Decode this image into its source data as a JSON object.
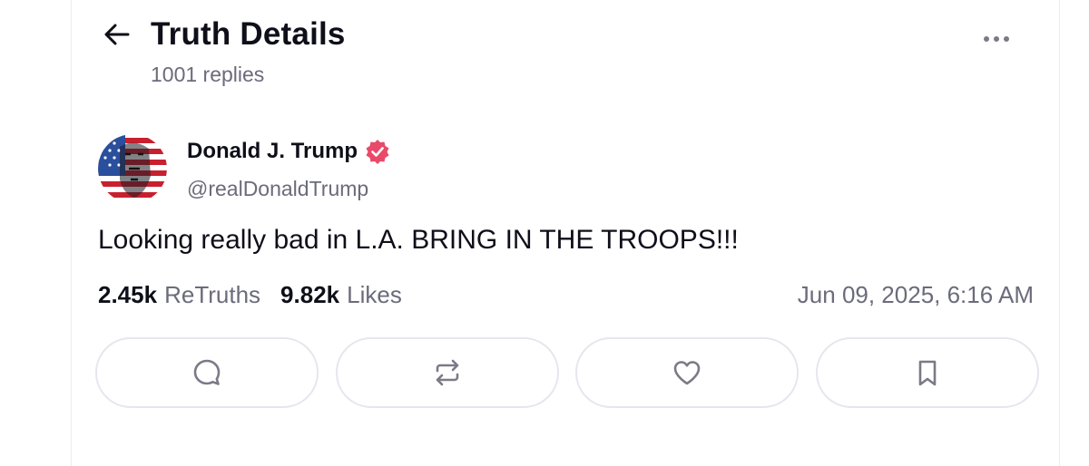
{
  "header": {
    "title": "Truth Details",
    "replies": "1001 replies",
    "back_icon": "arrow-left-icon",
    "more_icon": "ellipsis-icon"
  },
  "post": {
    "author_name": "Donald J. Trump",
    "handle": "@realDonaldTrump",
    "verified": true,
    "verified_color": "#e84a6a",
    "avatar_icon": "flag-portrait-avatar",
    "text": "Looking really bad in L.A. BRING IN THE TROOPS!!!",
    "retruths_count": "2.45k",
    "retruths_label": "ReTruths",
    "likes_count": "9.82k",
    "likes_label": "Likes",
    "timestamp": "Jun 09, 2025, 6:16 AM"
  },
  "actions": [
    {
      "name": "reply",
      "icon": "comment-icon"
    },
    {
      "name": "retruth",
      "icon": "repost-icon"
    },
    {
      "name": "like",
      "icon": "heart-icon"
    },
    {
      "name": "bookmark",
      "icon": "bookmark-icon"
    }
  ],
  "colors": {
    "text_primary": "#0f0f1a",
    "text_secondary": "#6b6b7b",
    "border": "#e6e6ee",
    "icon": "#7a7a88"
  }
}
